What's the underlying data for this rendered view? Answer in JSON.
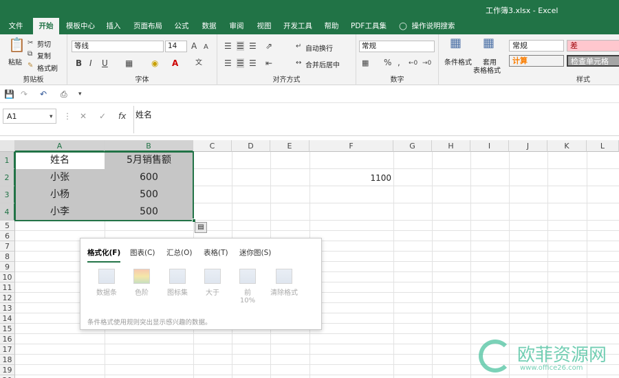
{
  "window": {
    "title": "工作簿3.xlsx  -  Excel"
  },
  "tabs": [
    "文件",
    "开始",
    "模板中心",
    "插入",
    "页面布局",
    "公式",
    "数据",
    "审阅",
    "视图",
    "开发工具",
    "帮助",
    "PDF工具集",
    "操作说明搜索"
  ],
  "ribbon": {
    "clipboard": {
      "paste": "粘贴",
      "cut": "剪切",
      "copy": "复制",
      "format_painter": "格式刷",
      "label": "剪贴板"
    },
    "font": {
      "name": "等线",
      "size": "14",
      "grow": "A",
      "shrink": "A",
      "bold": "B",
      "italic": "I",
      "underline": "U",
      "label": "字体"
    },
    "align": {
      "wrap": "自动换行",
      "merge": "合并后居中",
      "label": "对齐方式"
    },
    "number": {
      "format": "常规",
      "percent": "%",
      "comma": ",",
      "label": "数字"
    },
    "styles": {
      "conditional": "条件格式",
      "table_format_1": "套用",
      "table_format_2": "表格格式",
      "normal": "常规",
      "bad": "差",
      "calc": "计算",
      "check": "检查单元格",
      "label": "样式"
    }
  },
  "formula_bar": {
    "name_box": "A1",
    "fx": "fx",
    "content": "姓名"
  },
  "columns": [
    "A",
    "B",
    "C",
    "D",
    "E",
    "F",
    "G",
    "H",
    "I",
    "J",
    "K",
    "L"
  ],
  "rows": [
    "1",
    "2",
    "3",
    "4",
    "5",
    "6",
    "7",
    "8",
    "9",
    "10",
    "11",
    "12",
    "13",
    "14",
    "15",
    "16",
    "17",
    "18",
    "19",
    "20"
  ],
  "cells": {
    "a1": "姓名",
    "b1": "5月销售额",
    "a2": "小张",
    "b2": "600",
    "a3": "小杨",
    "b3": "500",
    "a4": "小李",
    "b4": "500",
    "f2": "1100"
  },
  "quick_analysis": {
    "tabs": [
      "格式化(F)",
      "图表(C)",
      "汇总(O)",
      "表格(T)",
      "迷你图(S)"
    ],
    "options": [
      "数据条",
      "色阶",
      "图标集",
      "大于",
      "前 10%",
      "清除格式"
    ],
    "description": "条件格式使用规则突出显示感兴趣的数据。"
  },
  "watermark": {
    "text": "欧菲资源网",
    "url": "www.office26.com"
  },
  "colors": {
    "brand": "#217346",
    "selection": "#c6c6c6"
  }
}
